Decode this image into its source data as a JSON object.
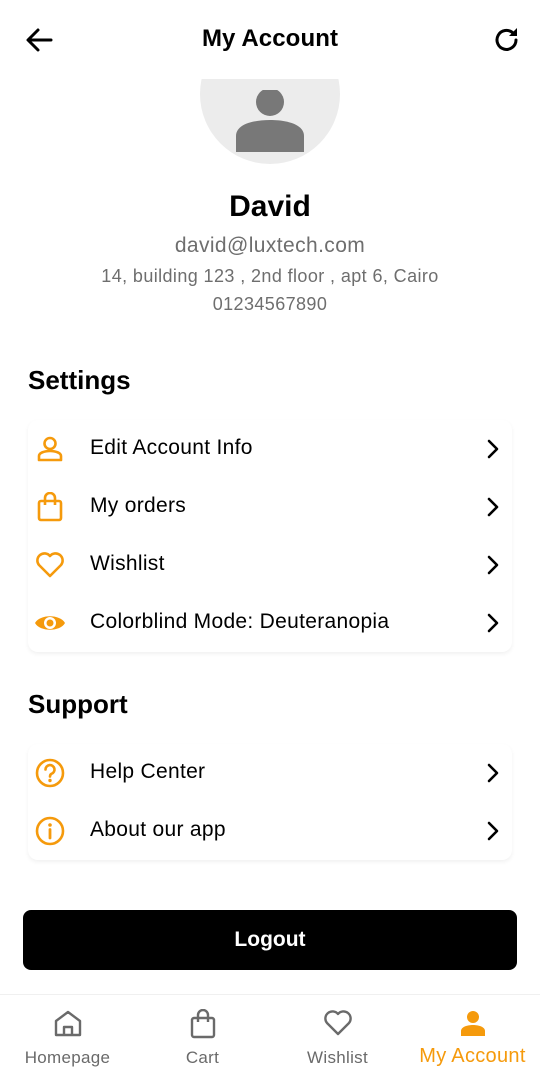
{
  "colors": {
    "accent": "#f59a0c",
    "text": "#000000",
    "muted": "#6e6e6e",
    "button": "#000000"
  },
  "appbar": {
    "title": "My Account",
    "back_icon": "arrow-left-icon",
    "refresh_icon": "refresh-icon"
  },
  "profile": {
    "name": "David",
    "email": "david@luxtech.com",
    "address": "14, building 123 , 2nd floor , apt 6, Cairo",
    "phone": "01234567890"
  },
  "settings": {
    "title": "Settings",
    "items": [
      {
        "label": "Edit Account Info",
        "icon": "person-icon"
      },
      {
        "label": "My orders",
        "icon": "shopping-bag-icon"
      },
      {
        "label": "Wishlist",
        "icon": "heart-icon"
      },
      {
        "label": "Colorblind Mode: Deuteranopia",
        "icon": "eye-icon"
      }
    ]
  },
  "support": {
    "title": "Support",
    "items": [
      {
        "label": "Help Center",
        "icon": "help-circle-icon"
      },
      {
        "label": "About our app",
        "icon": "info-icon"
      }
    ]
  },
  "logout_label": "Logout",
  "bottom_nav": {
    "items": [
      {
        "label": "Homepage",
        "icon": "home-icon",
        "active": false
      },
      {
        "label": "Cart",
        "icon": "shopping-bag-icon",
        "active": false
      },
      {
        "label": "Wishlist",
        "icon": "heart-icon",
        "active": false
      },
      {
        "label": "My Account",
        "icon": "person-icon",
        "active": true
      }
    ]
  }
}
